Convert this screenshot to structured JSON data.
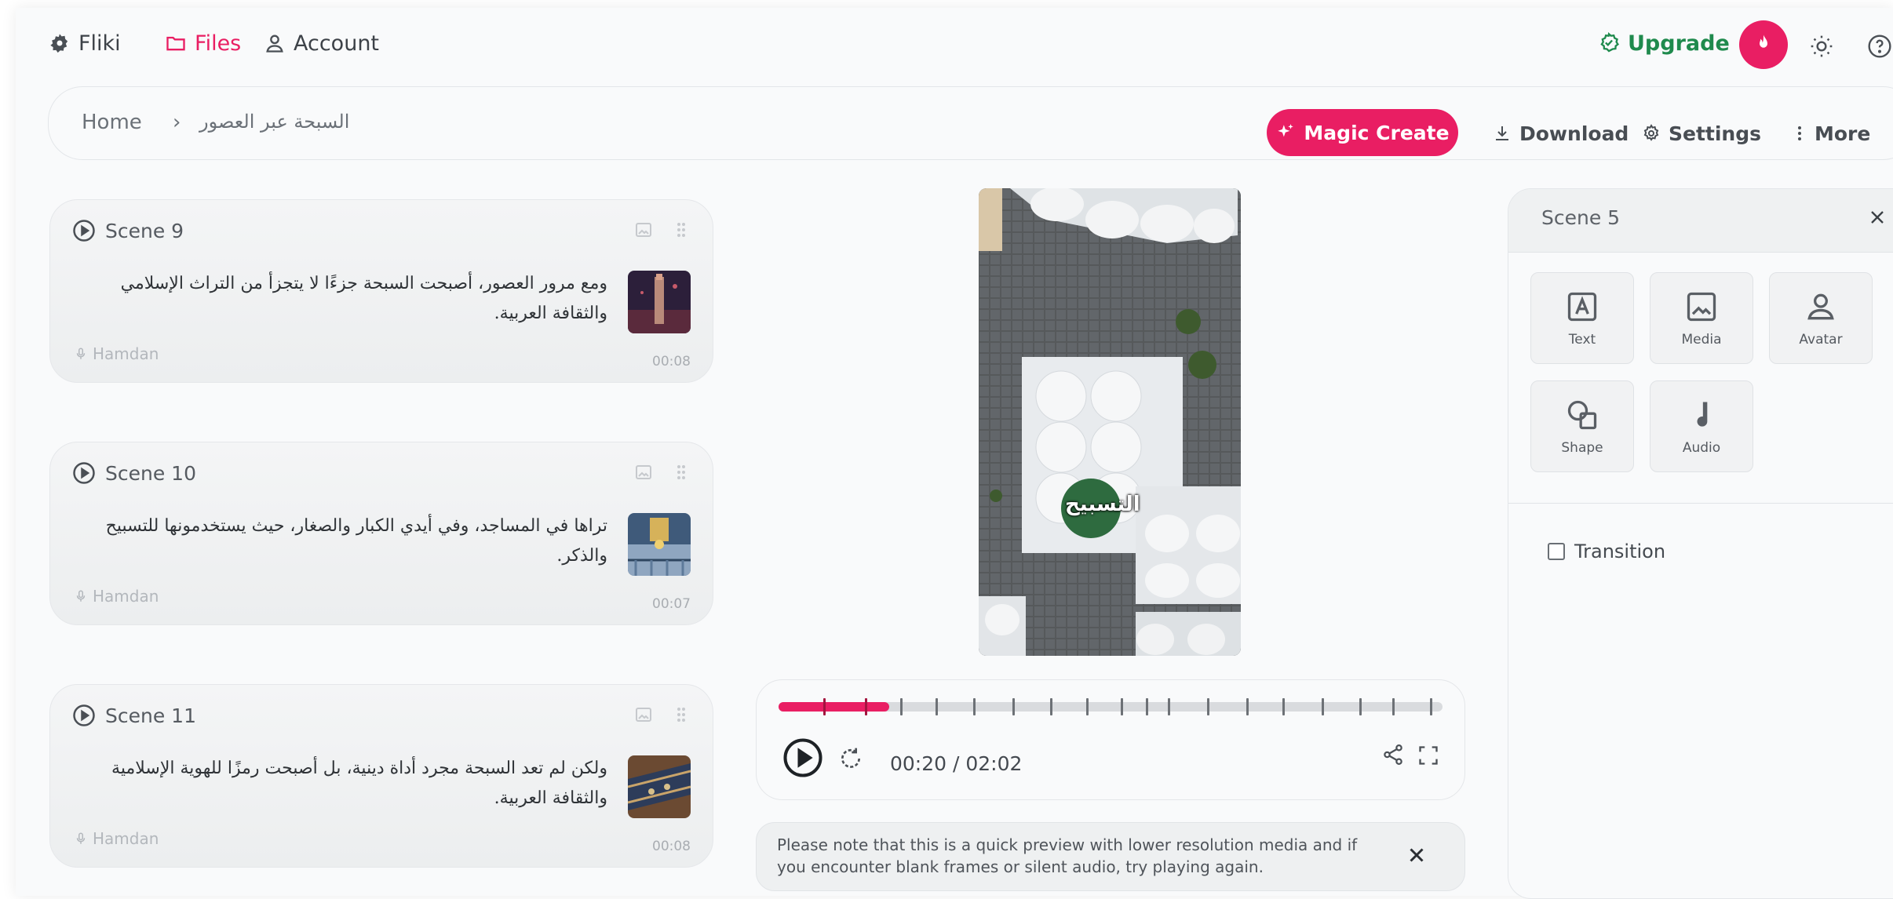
{
  "nav": {
    "brand": "Fliki",
    "files": "Files",
    "account": "Account",
    "upgrade": "Upgrade"
  },
  "breadcrumb": {
    "home": "Home",
    "separator": "›",
    "current": "السبحة عبر العصور"
  },
  "toolbar": {
    "magic_create": "Magic Create",
    "download": "Download",
    "settings": "Settings",
    "more": "More"
  },
  "scenes": [
    {
      "title": "Scene 9",
      "text": "ومع مرور العصور، أصبحت السبحة جزءًا لا يتجزأ من التراث الإسلامي والثقافة العربية.",
      "voice": "Hamdan",
      "duration": "00:08"
    },
    {
      "title": "Scene 10",
      "text": "تراها في المساجد، وفي أيدي الكبار والصغار، حيث يستخدمونها للتسبيح والذكر.",
      "voice": "Hamdan",
      "duration": "00:07"
    },
    {
      "title": "Scene 11",
      "text": "ولكن لم تعد السبحة مجرد أداة دينية، بل أصبحت رمزًا للهوية الإسلامية والثقافة العربية.",
      "voice": "Hamdan",
      "duration": "00:08"
    }
  ],
  "preview": {
    "caption": "التسبيح"
  },
  "player": {
    "time": "00:20 / 02:02",
    "progress": 0.167
  },
  "notice": {
    "text": "Please note that this is a quick preview with lower resolution media and if you encounter blank frames or silent audio, try playing again."
  },
  "panel": {
    "title": "Scene 5",
    "tiles": [
      "Text",
      "Media",
      "Avatar",
      "Shape",
      "Audio"
    ],
    "transition_label": "Transition",
    "transition_checked": false
  },
  "colors": {
    "accent": "#e91e63",
    "upgrade": "#1f8a4d"
  }
}
